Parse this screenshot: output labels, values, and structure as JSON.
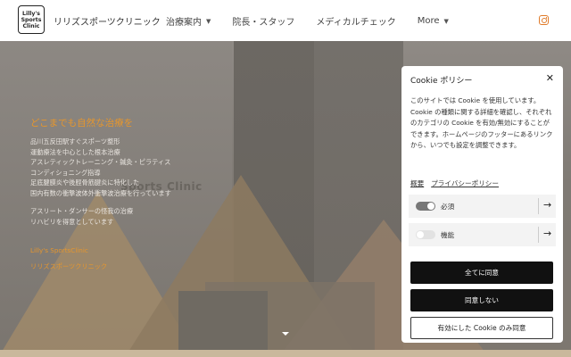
{
  "header": {
    "logo_lines": [
      "Lilly's",
      "Sports",
      "Clinic"
    ],
    "brand": "リリズスポーツクリニック",
    "nav": [
      {
        "label": "治療案内",
        "dropdown": true
      },
      {
        "label": "院長・スタッフ",
        "dropdown": false
      },
      {
        "label": "メディカルチェック",
        "dropdown": false
      },
      {
        "label": "More",
        "dropdown": true
      }
    ],
    "instagram_icon": "instagram-icon",
    "accent_color": "#e07b2a"
  },
  "hero": {
    "heading": "どこまでも自然な治療を",
    "lines_block1": [
      "品川五反田駅すぐスポーツ整形",
      "運動療法を中心とした根本治療",
      "アスレティックトレーニング・鍼灸・ピラティス",
      "コンディショニング指導",
      "足底腱膜炎や後脛骨筋腱炎に特化した",
      "国内有数の衝撃波体外衝撃波治療を行っています"
    ],
    "lines_block2": [
      "アスリート・ダンサーの怪我の治療",
      "リハビリを得意としています"
    ],
    "watermark": "Sports Clinic",
    "brand_en": "Lilly's SportsClinic",
    "brand_jp": "リリズスポーツクリニック",
    "heading_color": "#e5962e"
  },
  "cookie": {
    "title": "Cookie ポリシー",
    "close_icon": "close-icon",
    "description": "このサイトでは Cookie を使用しています。Cookie の種類に関する詳細を確認し、それぞれのカテゴリの Cookie を有効/無効にすることができます。ホームページのフッターにあるリンクから、いつでも設定を調整できます。",
    "links": [
      "概要",
      "プライバシーポリシー"
    ],
    "categories": [
      {
        "label": "必須",
        "enabled": true
      },
      {
        "label": "機能",
        "enabled": false
      }
    ],
    "buttons": {
      "accept_all": "全てに同意",
      "decline": "同意しない",
      "accept_selected": "有効にした Cookie のみ同意"
    }
  }
}
